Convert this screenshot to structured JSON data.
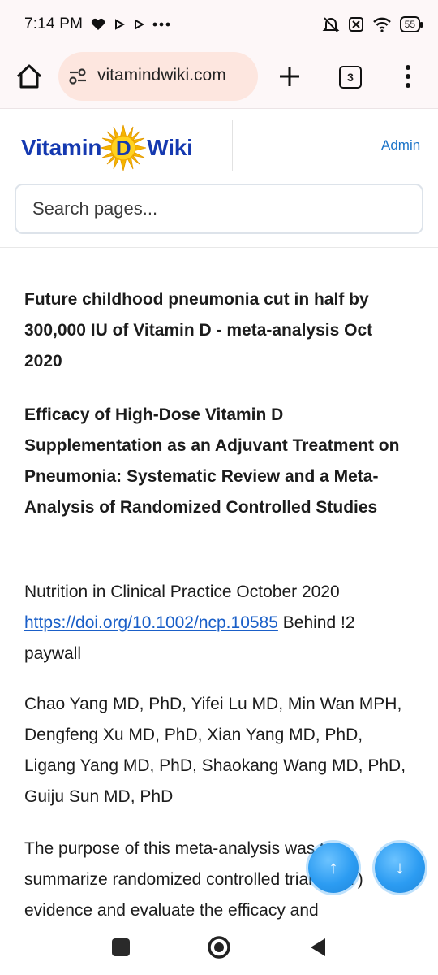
{
  "status_bar": {
    "time": "7:14 PM",
    "battery": "55",
    "icons": [
      "heart-icon",
      "play-icon",
      "play-icon",
      "more-dots-icon",
      "mute-icon",
      "sim-icon",
      "wifi-icon",
      "battery-icon"
    ]
  },
  "browser": {
    "url": "vitamindwiki.com",
    "tab_count": "3"
  },
  "site": {
    "logo_left": "Vitamin",
    "logo_d": "D",
    "logo_right": "Wiki",
    "admin_label": "Admin",
    "search_placeholder": "Search pages..."
  },
  "article": {
    "title": "Future childhood pneumonia cut in half by 300,000 IU of Vitamin D - meta-analysis Oct 2020",
    "paper_title": "Efficacy of High-Dose Vitamin D Supplementation as an Adjuvant Treatment on Pneumonia: Systematic Review and a Meta-Analysis of Randomized Controlled Studies",
    "journal": "Nutrition in Clinical Practice October 2020",
    "doi": "https://doi.org/10.1002/ncp.10585",
    "paywall": "Behind !2 paywall",
    "authors": "Chao Yang MD, PhD, Yifei Lu MD, Min Wan MPH, Dengfeng Xu MD, PhD, Xian Yang MD, PhD, Ligang Yang MD, PhD, Shaokang Wang MD, PhD, Guiju Sun MD, PhD",
    "purpose": "The purpose of this meta-analysis was to summarize randomized controlled trial (RCT) evidence and evaluate the efficacy and"
  },
  "fabs": {
    "up_label": "↑",
    "down_label": "↓"
  },
  "colors": {
    "brand_blue": "#1539b0",
    "link": "#1a5fc8",
    "url_pill": "#fde6df",
    "fab": "#2c9cf2"
  }
}
